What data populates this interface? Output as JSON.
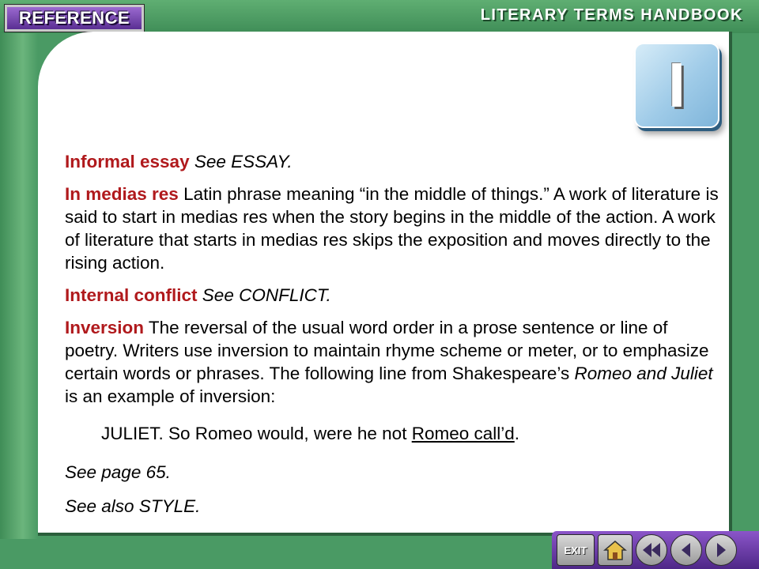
{
  "header": {
    "badge": "REFERENCE",
    "title": "LITERARY TERMS HANDBOOK"
  },
  "letter_tile": "I",
  "entries": [
    {
      "term": "Informal essay",
      "body": "See ESSAY."
    },
    {
      "term": "In medias res",
      "body": "Latin phrase meaning “in the middle of things.” A work of literature is said to start in medias res when the story begins in the middle of the action. A work of literature that starts in medias res skips the exposition and moves directly to the rising action."
    },
    {
      "term": "Internal conflict",
      "body": "See CONFLICT."
    },
    {
      "term": "Inversion",
      "body_a": "The reversal of the usual word order in a prose sentence or line of poetry. Writers use inversion to maintain rhyme scheme or meter, or to emphasize certain words or phrases. The following line from Shakespeare’s",
      "title": "Romeo and Juliet",
      "body_b": "is an example of inversion:"
    }
  ],
  "example": {
    "prefix": "JULIET. So Romeo would, were he not",
    "underlined": "Romeo call’d",
    "suffix": "."
  },
  "see_page": "See page 65.",
  "see_also": "See also STYLE.",
  "nav": {
    "exit_label": "EXIT",
    "icons": [
      "home-icon",
      "rewind-icon",
      "previous-icon",
      "next-icon"
    ]
  }
}
